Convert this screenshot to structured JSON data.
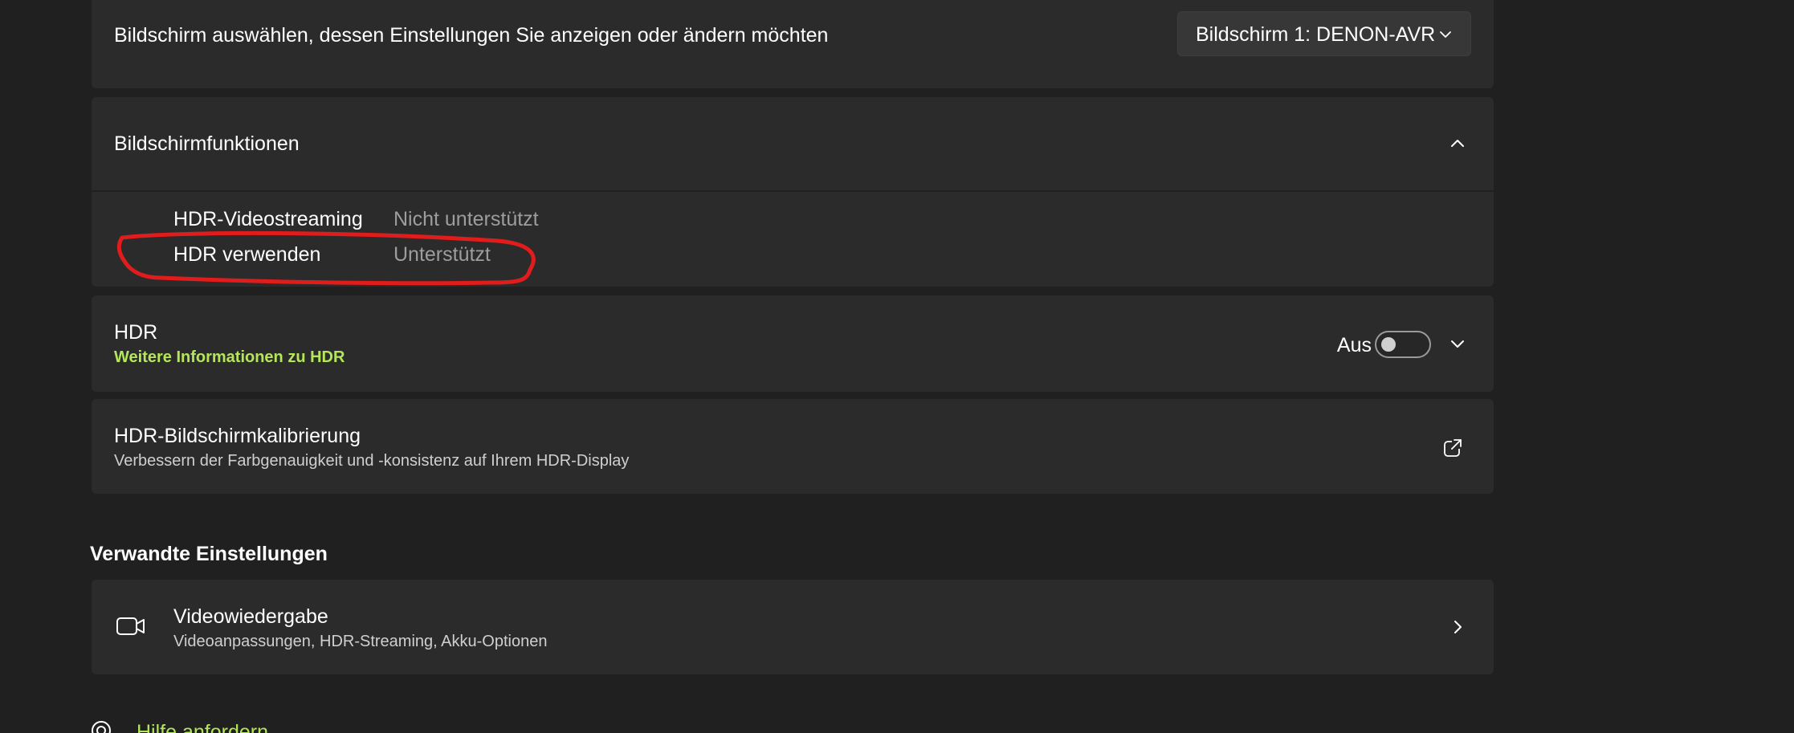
{
  "accent_color": "#b4e65a",
  "annotation_color": "#e01c1c",
  "display_select": {
    "label": "Bildschirm auswählen, dessen Einstellungen Sie anzeigen oder ändern möchten",
    "selected": "Bildschirm 1: DENON-AVR",
    "icon": "chevron-down-icon"
  },
  "display_features": {
    "title": "Bildschirmfunktionen",
    "expanded": true,
    "icon": "chevron-up-icon",
    "rows": [
      {
        "name": "HDR-Videostreaming",
        "value": "Nicht unterstützt"
      },
      {
        "name": "HDR verwenden",
        "value": "Unterstützt"
      }
    ]
  },
  "hdr": {
    "title": "HDR",
    "info_link": "Weitere Informationen zu HDR",
    "state_label": "Aus",
    "enabled": false,
    "icon": "chevron-down-icon"
  },
  "calibration": {
    "title": "HDR-Bildschirmkalibrierung",
    "subtitle": "Verbessern der Farbgenauigkeit und -konsistenz auf Ihrem HDR-Display",
    "icon": "open-external-icon"
  },
  "related": {
    "heading": "Verwandte Einstellungen",
    "items": [
      {
        "title": "Videowiedergabe",
        "subtitle": "Videoanpassungen, HDR-Streaming, Akku-Optionen",
        "icon": "video-camera-icon"
      }
    ]
  },
  "help": {
    "label": "Hilfe anfordern",
    "icon": "help-icon"
  }
}
